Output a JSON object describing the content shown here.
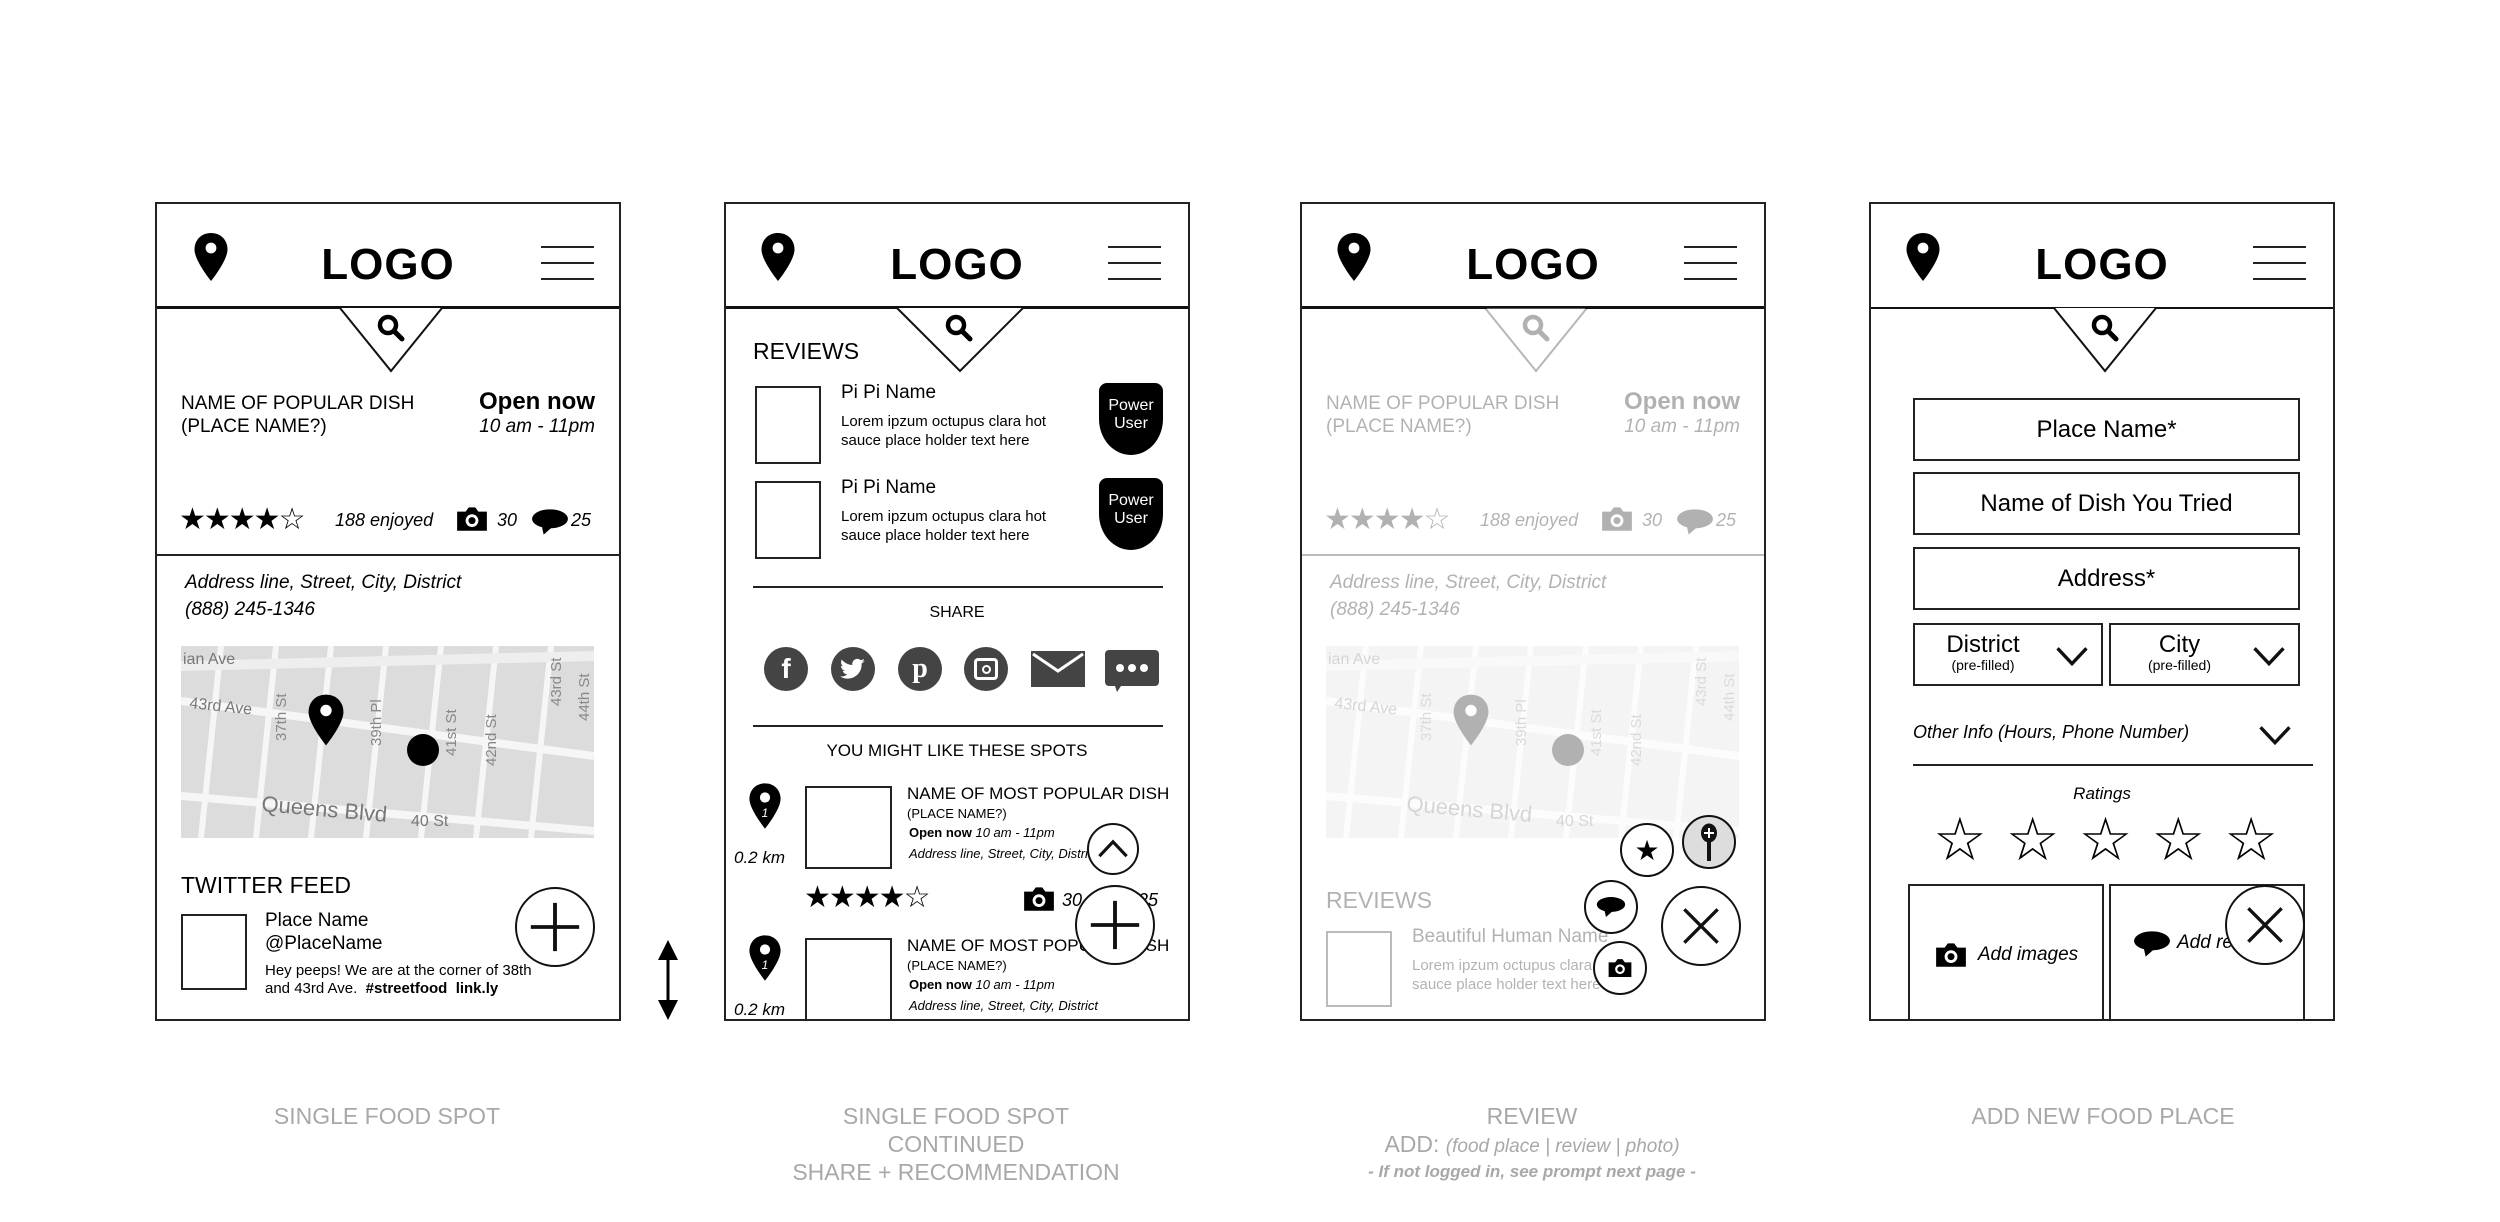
{
  "common": {
    "logo": "LOGO"
  },
  "screen1": {
    "dish_name": "NAME OF POPULAR DISH",
    "place_name": "(PLACE NAME?)",
    "open_status": "Open now",
    "hours": "10 am - 11pm",
    "rating": 4,
    "rating_max": 5,
    "rating_stars": "★★★★☆",
    "enjoyed": "188 enjoyed",
    "photos_count": "30",
    "comments_count": "25",
    "address": "Address line, Street, City, District",
    "phone": "(888) 245-1346",
    "twitter": {
      "title": "TWITTER FEED",
      "name": "Place Name",
      "handle": "@PlaceName",
      "text1": "Hey peeps! We are at the corner of 38th",
      "text2": "and 43rd Ave.",
      "hashtag": "#streetfood",
      "link": "link.ly"
    }
  },
  "screen2": {
    "reviews_title": "REVIEWS",
    "reviews": [
      {
        "name": "Pi Pi Name",
        "line1": "Lorem ipzum octupus clara hot",
        "line2": "sauce place holder text here",
        "badge1": "Power",
        "badge2": "User"
      },
      {
        "name": "Pi Pi Name",
        "line1": "Lorem ipzum octupus clara hot",
        "line2": "sauce place holder text here",
        "badge1": "Power",
        "badge2": "User"
      }
    ],
    "share_title": "SHARE",
    "share_icons": [
      "facebook-icon",
      "twitter-icon",
      "pinterest-icon",
      "instagram-icon",
      "email-icon",
      "more-icon"
    ],
    "suggest_title": "YOU MIGHT LIKE THESE SPOTS",
    "spots": [
      {
        "rank": "1",
        "distance": "0.2 km",
        "dish": "NAME OF MOST POPULAR DISH",
        "place": "(PLACE NAME?)",
        "open": "Open now",
        "hours": "10 am - 11pm",
        "address": "Address line, Street, City, District",
        "stars": "★★★★☆",
        "photos": "30",
        "comments": "25"
      },
      {
        "rank": "1",
        "distance": "0.2 km",
        "dish": "NAME OF MOST POPULAR DISH",
        "place": "(PLACE NAME?)",
        "open": "Open now",
        "hours": "10 am - 11pm",
        "address": "Address line, Street, City, District"
      }
    ]
  },
  "screen3": {
    "reviews_title": "REVIEWS",
    "review_name": "Beautiful Human Name",
    "review_line1": "Lorem ipzum octupus clara hot",
    "review_line2": "sauce place holder text here"
  },
  "screen4": {
    "place_name": "Place Name*",
    "dish_name": "Name of Dish You Tried",
    "address": "Address*",
    "district": "District",
    "city": "City",
    "prefilled": "(pre-filled)",
    "other_info": "Other Info (Hours, Phone Number)",
    "ratings_label": "Ratings",
    "add_images": "Add images",
    "add_review": "Add re"
  },
  "captions": {
    "c1": "SINGLE FOOD SPOT",
    "c2a": "SINGLE FOOD SPOT",
    "c2b": "CONTINUED",
    "c2c": "SHARE + RECOMMENDATION",
    "c3a": "REVIEW",
    "c3b": "ADD:",
    "c3c": "(food place | review | photo)",
    "c3d": "- If not logged in, see prompt next page -",
    "c4": "ADD NEW FOOD PLACE"
  }
}
